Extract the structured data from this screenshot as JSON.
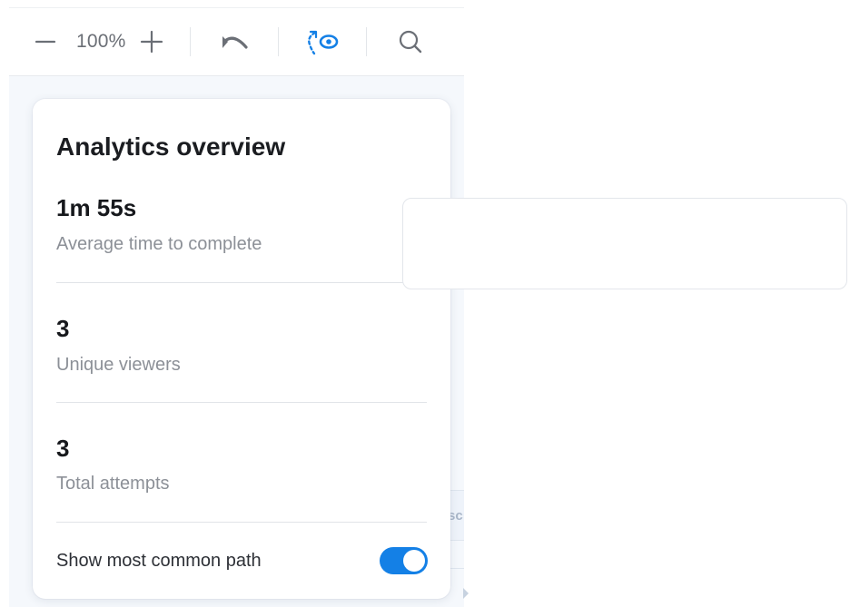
{
  "toolbar": {
    "zoom_out_icon": "minus-icon",
    "zoom_level": "100%",
    "zoom_in_icon": "plus-icon",
    "undo_icon": "undo-icon",
    "path_view_icon": "path-eye-icon",
    "search_icon": "search-icon",
    "accent_color": "#1480e6"
  },
  "canvas": {
    "partial_text": "sc"
  },
  "analytics": {
    "title": "Analytics overview",
    "stats": [
      {
        "value": "1m 55s",
        "label": "Average time to complete"
      },
      {
        "value": "3",
        "label": "Unique viewers"
      },
      {
        "value": "3",
        "label": "Total attempts"
      }
    ],
    "toggle": {
      "label": "Show most common path",
      "on": true,
      "color": "#1480e6"
    }
  }
}
